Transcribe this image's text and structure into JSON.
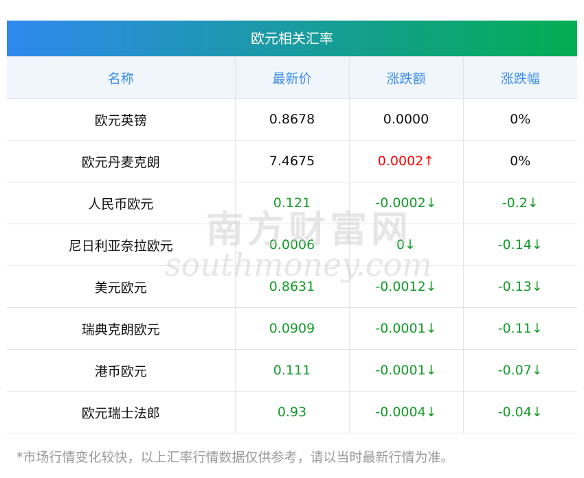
{
  "title": "欧元相关汇率",
  "columns": [
    "名称",
    "最新价",
    "涨跌额",
    "涨跌幅"
  ],
  "rows": [
    {
      "name": "欧元英镑",
      "price": "0.8678",
      "change": "0.0000",
      "pct": "0%",
      "dir": "flat"
    },
    {
      "name": "欧元丹麦克朗",
      "price": "7.4675",
      "change": "0.0002↑",
      "pct": "0%",
      "dir": "up"
    },
    {
      "name": "人民币欧元",
      "price": "0.121",
      "change": "-0.0002↓",
      "pct": "-0.2↓",
      "dir": "down"
    },
    {
      "name": "尼日利亚奈拉欧元",
      "price": "0.0006",
      "change": "0↓",
      "pct": "-0.14↓",
      "dir": "down"
    },
    {
      "name": "美元欧元",
      "price": "0.8631",
      "change": "-0.0012↓",
      "pct": "-0.13↓",
      "dir": "down"
    },
    {
      "name": "瑞典克朗欧元",
      "price": "0.0909",
      "change": "-0.0001↓",
      "pct": "-0.11↓",
      "dir": "down"
    },
    {
      "name": "港币欧元",
      "price": "0.111",
      "change": "-0.0001↓",
      "pct": "-0.07↓",
      "dir": "down"
    },
    {
      "name": "欧元瑞士法郎",
      "price": "0.93",
      "change": "-0.0004↓",
      "pct": "-0.04↓",
      "dir": "down"
    }
  ],
  "watermark": {
    "cn": "南方财富网",
    "en": "southmoney.com"
  },
  "note": "*市场行情变化较快，以上汇率行情数据仅供参考，请以当时最新行情为准。"
}
